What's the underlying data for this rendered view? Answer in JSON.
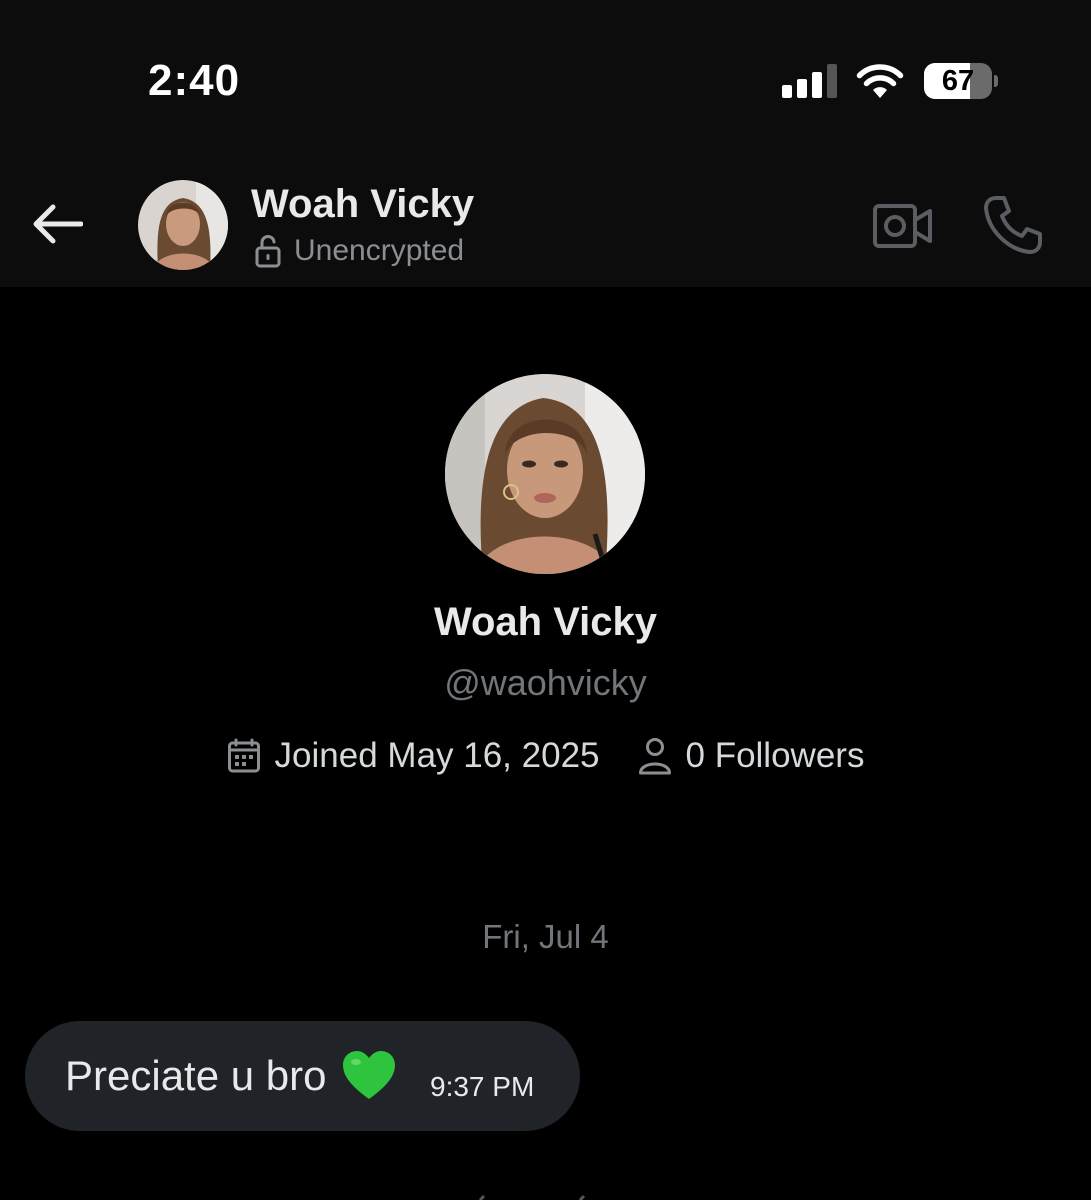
{
  "status_bar": {
    "time": "2:40",
    "battery_level": "67",
    "battery_fraction": 0.67
  },
  "header": {
    "back_icon": "arrow-left-icon",
    "contact_name": "Woah Vicky",
    "encryption_status": "Unencrypted",
    "lock_icon": "unlocked-icon",
    "video_icon": "video-camera-icon",
    "phone_icon": "phone-icon"
  },
  "profile": {
    "name": "Woah Vicky",
    "handle": "@waohvicky",
    "joined": "Joined May 16, 2025",
    "followers": "0 Followers",
    "calendar_icon": "calendar-icon",
    "person_icon": "person-icon"
  },
  "conversation": {
    "date_separator": "Fri, Jul 4",
    "messages": [
      {
        "text": "Preciate u bro",
        "emoji_icon": "green-heart-icon",
        "time": "9:37 PM"
      }
    ]
  },
  "colors": {
    "background": "#000000",
    "header_background": "#0c0c0c",
    "bubble": "#202327",
    "muted_text": "#71767b",
    "heart": "#2fc43d"
  }
}
